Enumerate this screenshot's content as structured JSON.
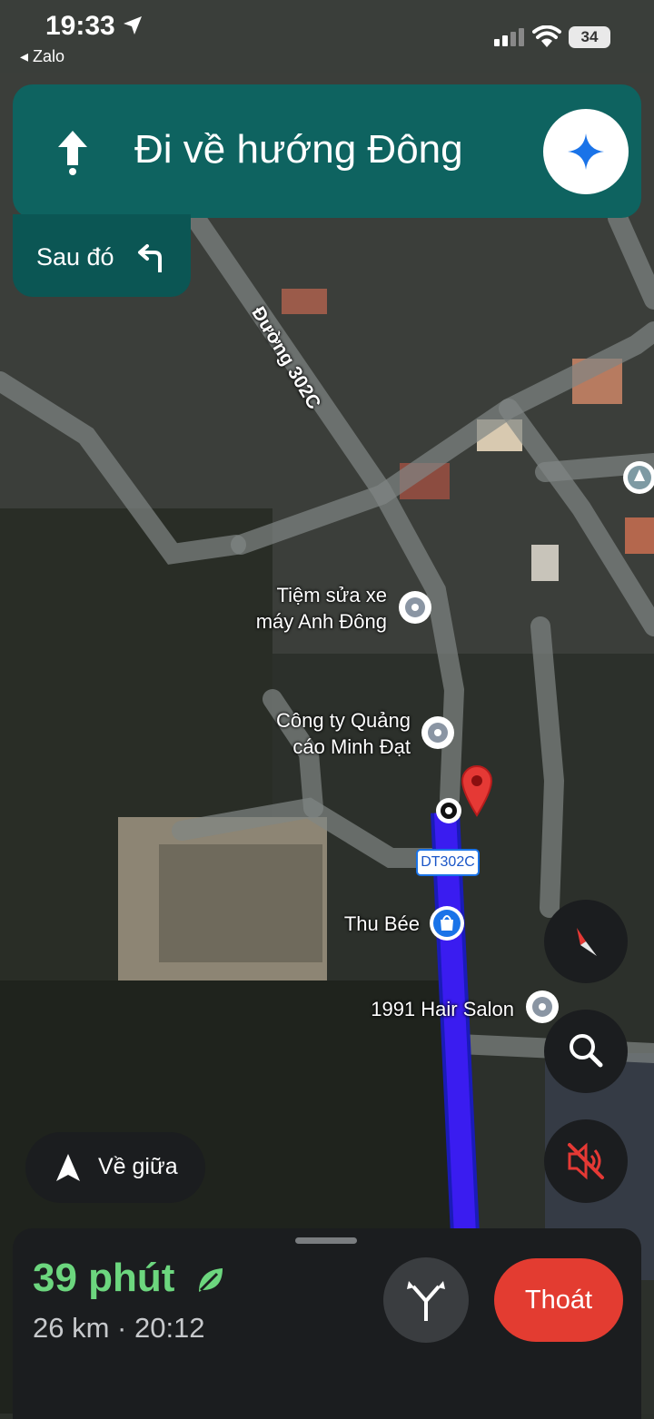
{
  "status_bar": {
    "time": "19:33",
    "back_app": "Zalo",
    "battery": "34"
  },
  "navigation": {
    "instruction": "Đi về hướng Đông",
    "maneuver_icon": "straight-arrow-icon",
    "then_label": "Sau đó",
    "then_icon": "turn-left-icon"
  },
  "map": {
    "road_label": "Đường 302C",
    "route_shield": "DT302C",
    "places": [
      {
        "name": "Tiệm sửa xe",
        "name_line2": "máy Anh Đông"
      },
      {
        "name": "Công ty Quảng",
        "name_line2": "cáo Minh Đạt"
      },
      {
        "name": "Thu Bée"
      },
      {
        "name": "1991 Hair Salon"
      }
    ]
  },
  "controls": {
    "recenter_label": "Về giữa",
    "compass_icon": "compass-icon",
    "search_icon": "search-icon",
    "sound_icon": "sound-off-icon"
  },
  "trip": {
    "eta_minutes": "39 phút",
    "details": "26 km · 20:12",
    "exit_label": "Thoát"
  },
  "colors": {
    "banner": "#0e6360",
    "route": "#3a1cf0",
    "eta_green": "#6cd67e",
    "exit_red": "#e33c31"
  }
}
